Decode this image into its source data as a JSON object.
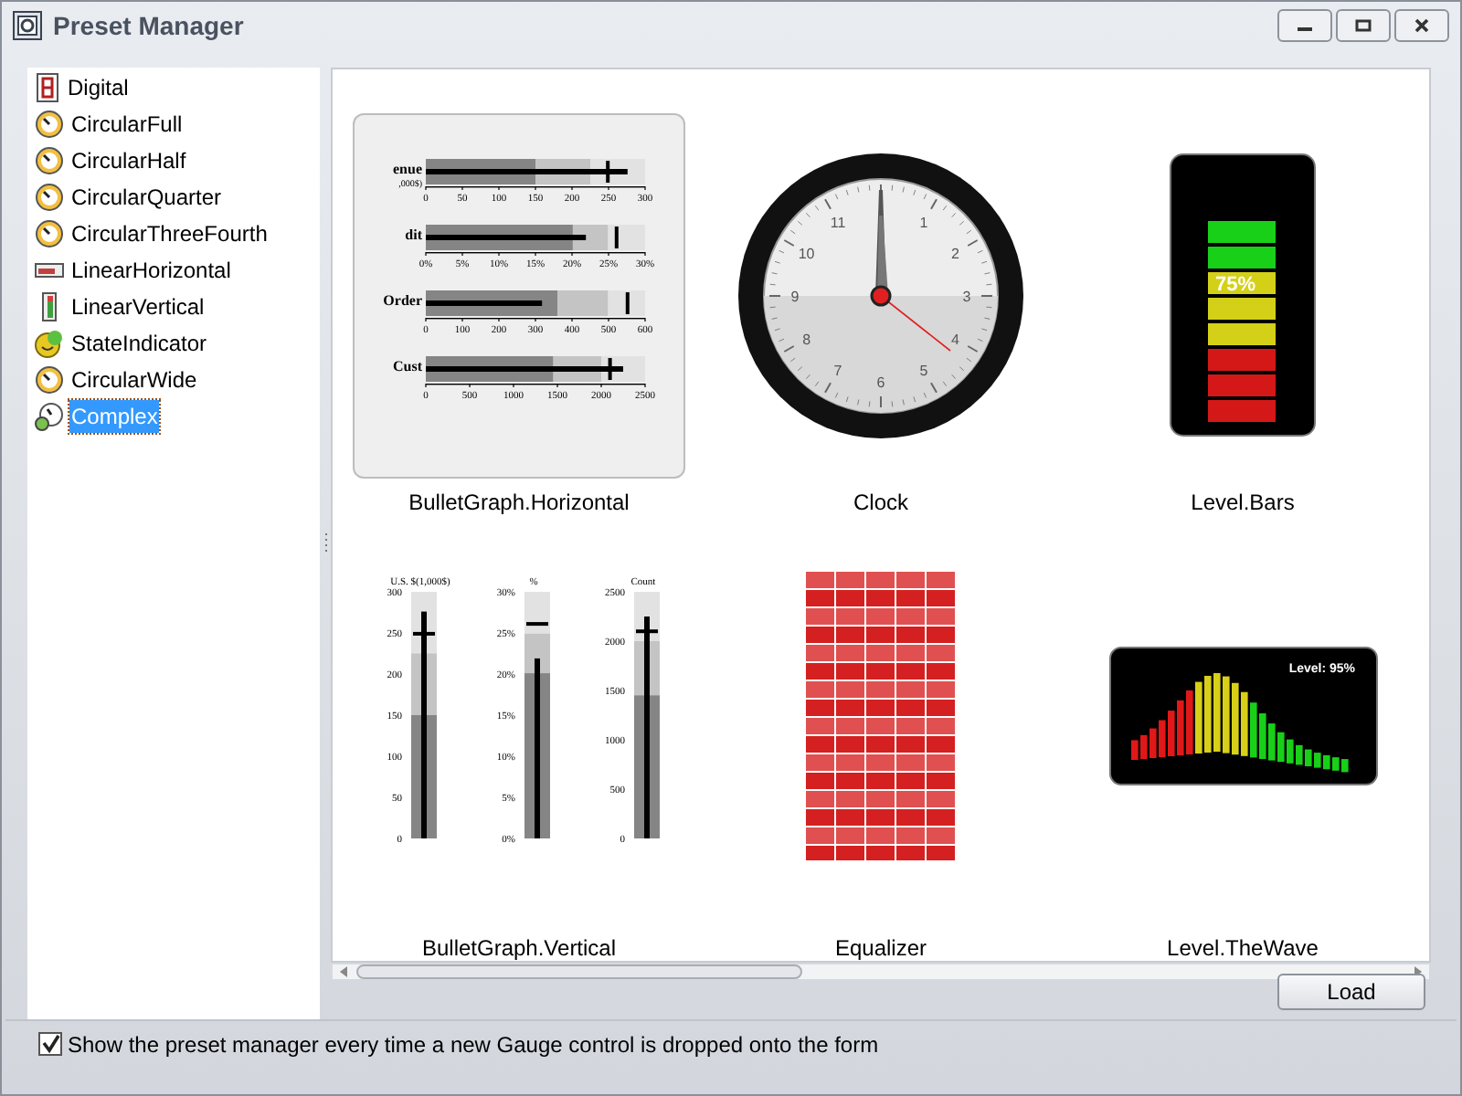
{
  "window": {
    "title": "Preset Manager"
  },
  "presets_list": [
    {
      "label": "Digital",
      "kind": "digital",
      "selected": false
    },
    {
      "label": "CircularFull",
      "kind": "circular",
      "selected": false
    },
    {
      "label": "CircularHalf",
      "kind": "circular",
      "selected": false
    },
    {
      "label": "CircularQuarter",
      "kind": "circular",
      "selected": false
    },
    {
      "label": "CircularThreeFourth",
      "kind": "circular",
      "selected": false
    },
    {
      "label": "LinearHorizontal",
      "kind": "linear_h",
      "selected": false
    },
    {
      "label": "LinearVertical",
      "kind": "linear_v",
      "selected": false
    },
    {
      "label": "StateIndicator",
      "kind": "state",
      "selected": false
    },
    {
      "label": "CircularWide",
      "kind": "circular",
      "selected": false
    },
    {
      "label": "Complex",
      "kind": "complex",
      "selected": true
    }
  ],
  "gallery": [
    {
      "label": "BulletGraph.Horizontal",
      "kind": "bullet_h",
      "selected": true,
      "rows": [
        {
          "title": "enue",
          "subtitle": ",000$)",
          "ticks": [
            "0",
            "50",
            "100",
            "150",
            "200",
            "250",
            "300"
          ]
        },
        {
          "title": "dit",
          "ticks": [
            "0%",
            "5%",
            "10%",
            "15%",
            "20%",
            "25%",
            "30%"
          ]
        },
        {
          "title": "Order",
          "ticks": [
            "0",
            "100",
            "200",
            "300",
            "400",
            "500",
            "600"
          ]
        },
        {
          "title": "Cust",
          "ticks": [
            "0",
            "500",
            "1000",
            "1500",
            "2000",
            "2500"
          ]
        }
      ]
    },
    {
      "label": "Clock",
      "kind": "clock",
      "selected": false,
      "numerals": [
        "1",
        "2",
        "3",
        "4",
        "5",
        "6",
        "7",
        "8",
        "9",
        "10",
        "11"
      ]
    },
    {
      "label": "Level.Bars",
      "kind": "level_bars",
      "selected": false,
      "reading": "75%"
    },
    {
      "label": "BulletGraph.Vertical",
      "kind": "bullet_v",
      "selected": false,
      "columns": [
        {
          "title": "U.S. $(1,000$)",
          "ticks": [
            "300",
            "250",
            "200",
            "150",
            "100",
            "50",
            "0"
          ]
        },
        {
          "title": "%",
          "ticks": [
            "30%",
            "25%",
            "20%",
            "15%",
            "10%",
            "5%",
            "0%"
          ]
        },
        {
          "title": "Count",
          "ticks": [
            "2500",
            "2000",
            "1500",
            "1000",
            "500",
            "0"
          ]
        }
      ]
    },
    {
      "label": "Equalizer",
      "kind": "equalizer",
      "selected": false
    },
    {
      "label": "Level.TheWave",
      "kind": "wave",
      "selected": false,
      "reading": "Level: 95%"
    }
  ],
  "load_button": "Load",
  "show_on_drop": {
    "label": "Show the preset manager every time a new Gauge control is dropped onto the form",
    "checked": true
  }
}
